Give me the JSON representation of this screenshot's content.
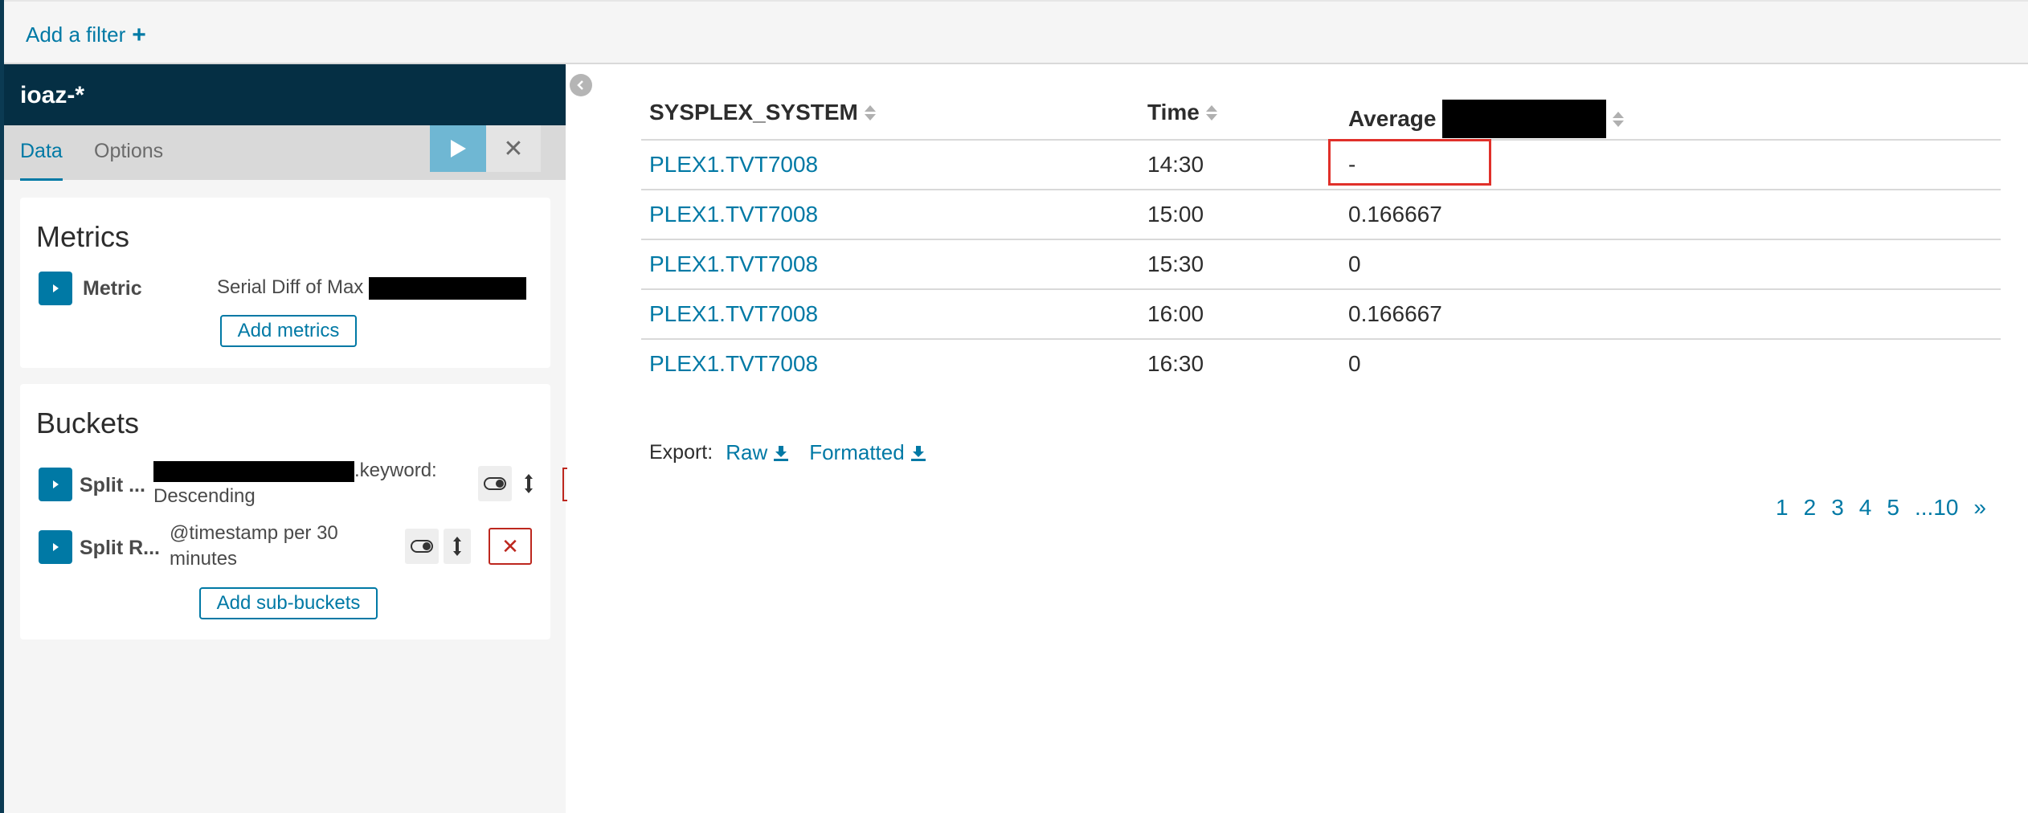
{
  "filter_bar": {
    "add_filter_label": "Add a filter"
  },
  "sidebar": {
    "index_pattern": "ioaz-*",
    "tabs": [
      {
        "label": "Data"
      },
      {
        "label": "Options"
      }
    ],
    "metrics": {
      "title": "Metrics",
      "row": {
        "label": "Metric",
        "description": "Serial Diff of Max"
      },
      "add_label": "Add metrics"
    },
    "buckets": {
      "title": "Buckets",
      "rows": [
        {
          "label": "Split ...",
          "desc_suffix": ".keyword:",
          "desc_line2": "Descending"
        },
        {
          "label": "Split R...",
          "desc_line1": "@timestamp per 30",
          "desc_line2": "minutes"
        }
      ],
      "add_label": "Add sub-buckets"
    }
  },
  "table": {
    "columns": [
      "SYSPLEX_SYSTEM",
      "Time",
      "Average"
    ],
    "rows": [
      {
        "system": "PLEX1.TVT7008",
        "time": "14:30",
        "average": "-"
      },
      {
        "system": "PLEX1.TVT7008",
        "time": "15:00",
        "average": "0.166667"
      },
      {
        "system": "PLEX1.TVT7008",
        "time": "15:30",
        "average": "0"
      },
      {
        "system": "PLEX1.TVT7008",
        "time": "16:00",
        "average": "0.166667"
      },
      {
        "system": "PLEX1.TVT7008",
        "time": "16:30",
        "average": "0"
      }
    ]
  },
  "export": {
    "label": "Export:",
    "raw": "Raw",
    "formatted": "Formatted"
  },
  "pagination": {
    "pages": [
      "1",
      "2",
      "3",
      "4",
      "5",
      "...10"
    ],
    "next": "»"
  },
  "colors": {
    "accent": "#0079a5",
    "header": "#052f44",
    "danger": "#bd271e",
    "highlight": "#e0302a"
  }
}
